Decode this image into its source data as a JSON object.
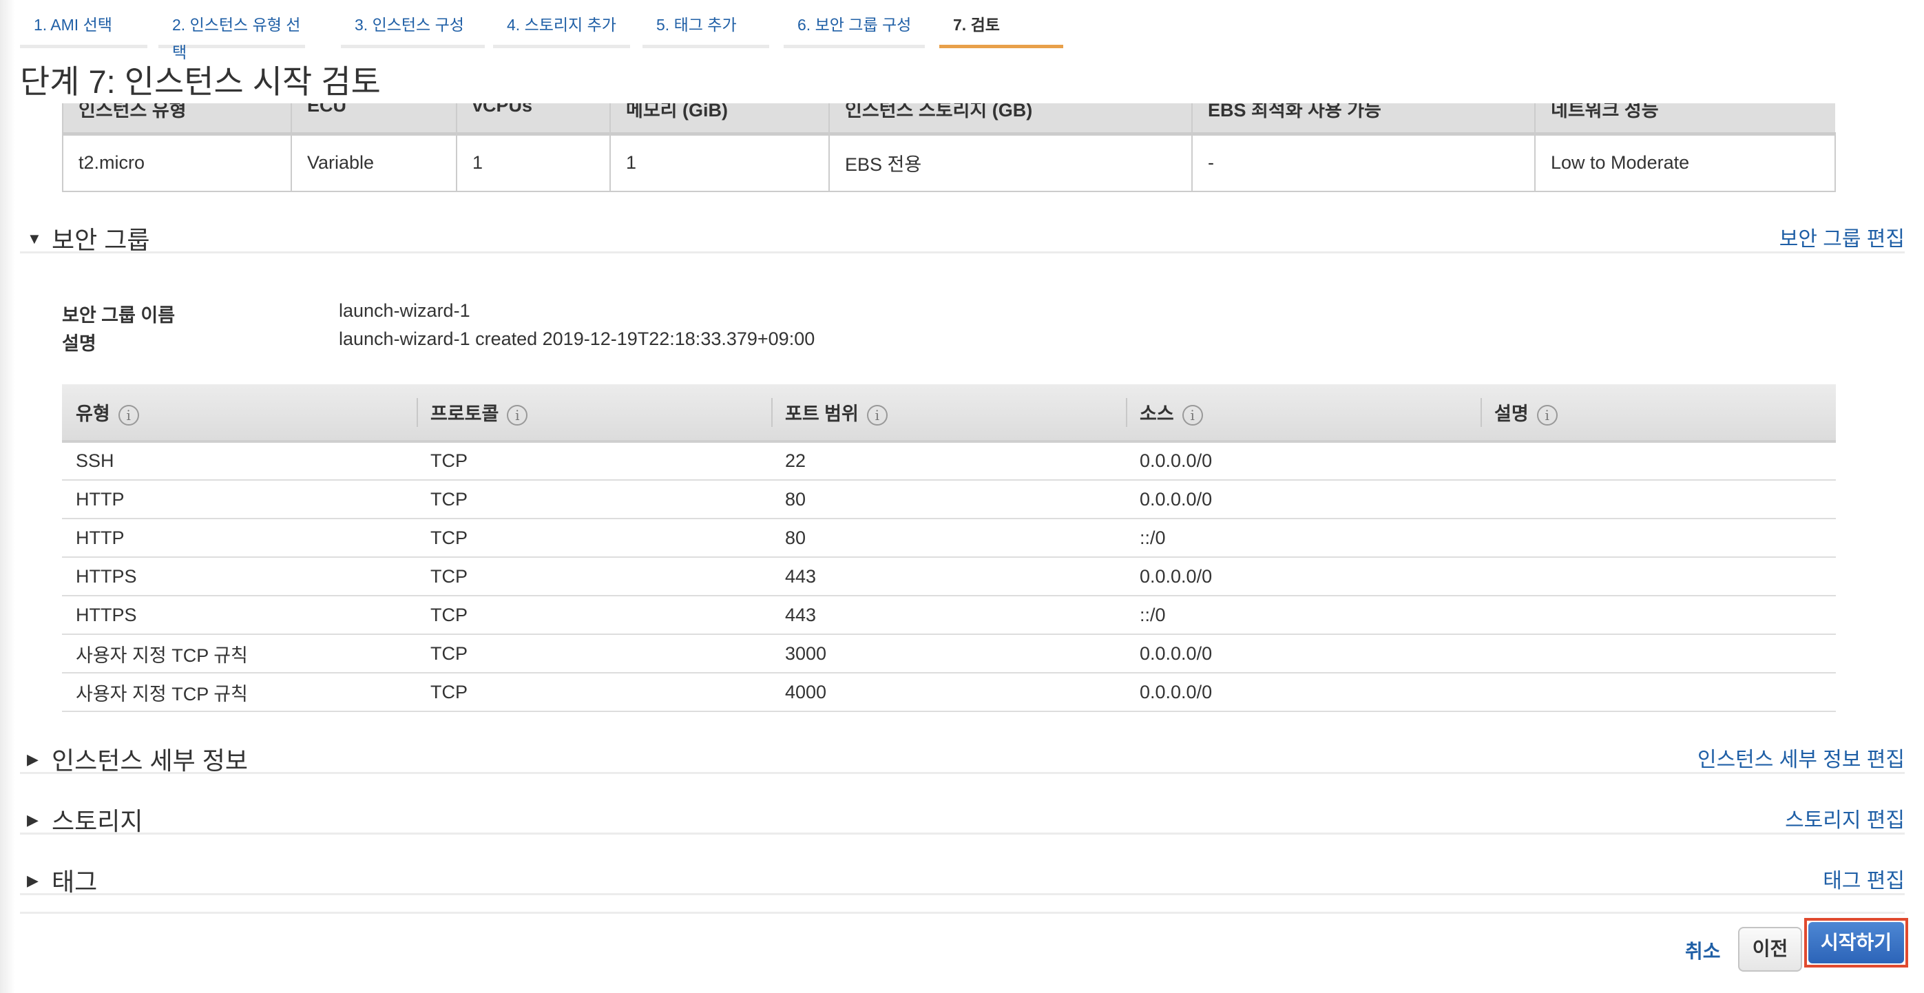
{
  "wizard_tabs": [
    {
      "label": "1. AMI 선택"
    },
    {
      "label": "2. 인스턴스 유형 선택"
    },
    {
      "label": "3. 인스턴스 구성"
    },
    {
      "label": "4. 스토리지 추가"
    },
    {
      "label": "5. 태그 추가"
    },
    {
      "label": "6. 보안 그룹 구성"
    },
    {
      "label": "7. 검토",
      "active": true
    }
  ],
  "page_title": "단계 7: 인스턴스 시작 검토",
  "instance_table": {
    "headers": [
      "인스턴스 유형",
      "ECU",
      "vCPUs",
      "메모리 (GiB)",
      "인스턴스 스토리지 (GB)",
      "EBS 최적화 사용 가능",
      "네트워크 성능"
    ],
    "row": [
      "t2.micro",
      "Variable",
      "1",
      "1",
      "EBS 전용",
      "-",
      "Low to Moderate"
    ]
  },
  "security_group": {
    "title": "보안 그룹",
    "edit_label": "보안 그룹 편집",
    "expanded": true,
    "name_label": "보안 그룹 이름",
    "name_value": "launch-wizard-1",
    "desc_label": "설명",
    "desc_value": "launch-wizard-1 created 2019-12-19T22:18:33.379+09:00",
    "headers": [
      "유형",
      "프로토콜",
      "포트 범위",
      "소스",
      "설명"
    ],
    "rows": [
      [
        "SSH",
        "TCP",
        "22",
        "0.0.0.0/0",
        ""
      ],
      [
        "HTTP",
        "TCP",
        "80",
        "0.0.0.0/0",
        ""
      ],
      [
        "HTTP",
        "TCP",
        "80",
        "::/0",
        ""
      ],
      [
        "HTTPS",
        "TCP",
        "443",
        "0.0.0.0/0",
        ""
      ],
      [
        "HTTPS",
        "TCP",
        "443",
        "::/0",
        ""
      ],
      [
        "사용자 지정 TCP 규칙",
        "TCP",
        "3000",
        "0.0.0.0/0",
        ""
      ],
      [
        "사용자 지정 TCP 규칙",
        "TCP",
        "4000",
        "0.0.0.0/0",
        ""
      ]
    ]
  },
  "sections": [
    {
      "title": "인스턴스 세부 정보",
      "edit_label": "인스턴스 세부 정보 편집"
    },
    {
      "title": "스토리지",
      "edit_label": "스토리지 편집"
    },
    {
      "title": "태그",
      "edit_label": "태그 편집"
    }
  ],
  "footer": {
    "cancel": "취소",
    "previous": "이전",
    "launch": "시작하기"
  },
  "colors": {
    "link": "#1f5fa6",
    "active_tab": "#e8a04a",
    "primary_button": "#2c64b8",
    "highlight_border": "#e04a2f"
  }
}
